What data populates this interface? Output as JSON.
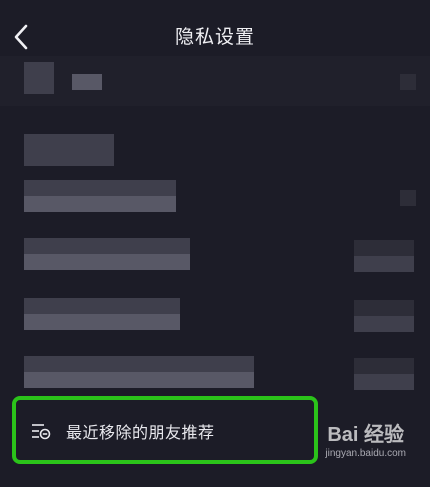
{
  "header": {
    "title": "隐私设置"
  },
  "bottom_item": {
    "label": "最近移除的朋友推荐"
  },
  "watermark": {
    "logo": "Bai 经验",
    "url": "jingyan.baidu.com"
  },
  "colors": {
    "background": "#1c1c27",
    "highlight": "#2bc31a",
    "text": "#e9e9ee"
  },
  "icons": {
    "back": "chevron-left-icon",
    "list": "list-remove-icon"
  }
}
